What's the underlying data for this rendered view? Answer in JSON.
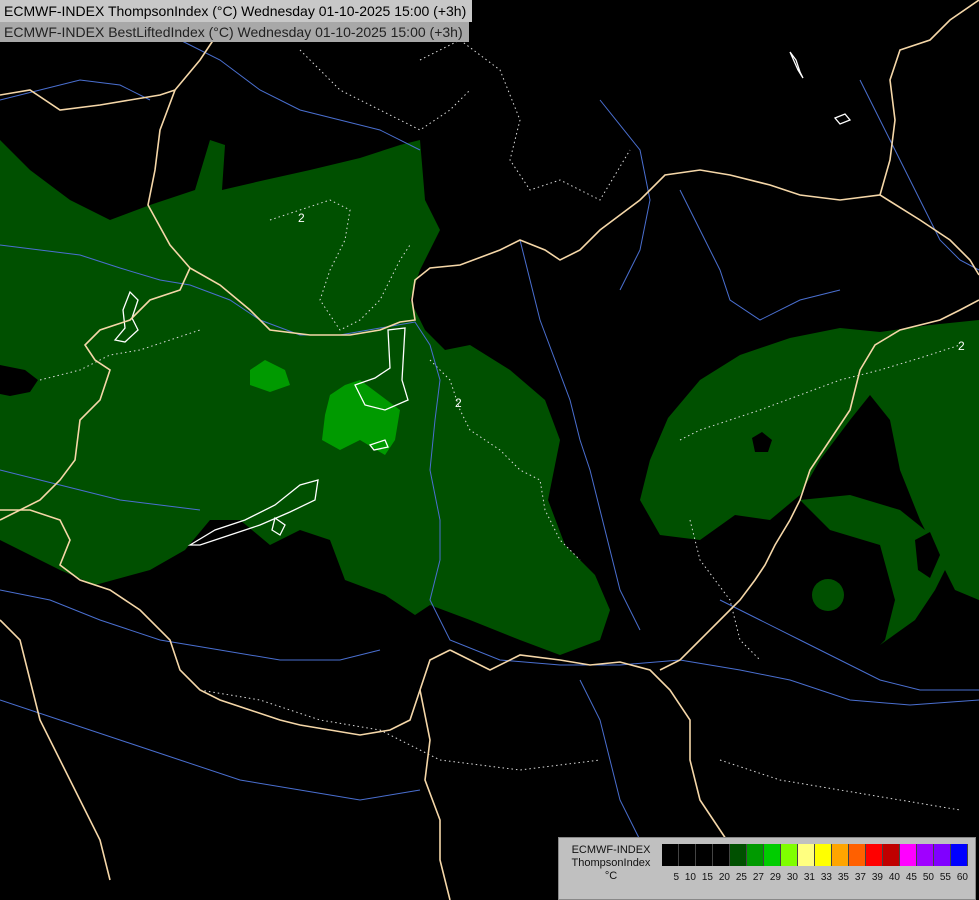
{
  "header": {
    "line1": "ECMWF-INDEX ThompsonIndex (°C) Wednesday 01-10-2025 15:00 (+3h)",
    "line2": "ECMWF-INDEX BestLiftedIndex (°C) Wednesday 01-10-2025 15:00 (+3h)"
  },
  "legend": {
    "model": "ECMWF-INDEX",
    "parameter": "ThompsonIndex",
    "unit": "°C",
    "colors": [
      "#000000",
      "#000000",
      "#000000",
      "#000000",
      "#005000",
      "#009a00",
      "#00cd00",
      "#7fff00",
      "#ffff80",
      "#ffff00",
      "#ffa500",
      "#ff6000",
      "#ff0000",
      "#c00000",
      "#ff00ff",
      "#a000ff",
      "#8000ff",
      "#0000ff"
    ],
    "ticks": [
      "5",
      "10",
      "15",
      "20",
      "25",
      "27",
      "29",
      "30",
      "31",
      "33",
      "35",
      "37",
      "39",
      "40",
      "45",
      "50",
      "55",
      "60"
    ]
  },
  "map": {
    "fill_colors": {
      "level1": "#005000",
      "level2": "#009a00",
      "outline": "#ffffff"
    },
    "border_color": "#f5d7a8",
    "river_color": "#4a6fd0",
    "contour_label": "2"
  }
}
